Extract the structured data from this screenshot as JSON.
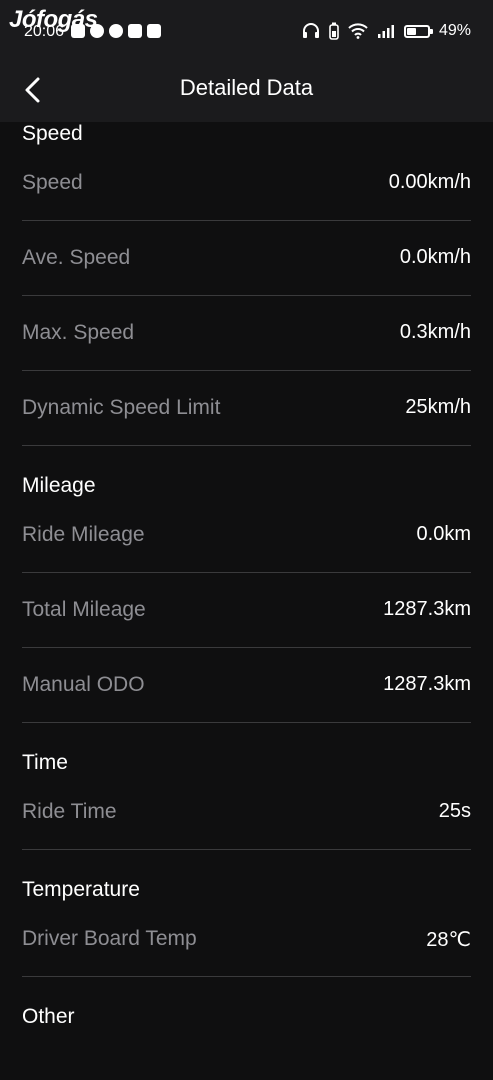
{
  "status_bar": {
    "watermark": "Jófogás",
    "time": "20:06",
    "battery_percent": "49%",
    "battery_level": 0.49
  },
  "header": {
    "title": "Detailed Data"
  },
  "sections": {
    "speed": {
      "title": "Speed",
      "rows": [
        {
          "label": "Speed",
          "value": "0.00km/h"
        },
        {
          "label": "Ave. Speed",
          "value": "0.0km/h"
        },
        {
          "label": "Max. Speed",
          "value": "0.3km/h"
        },
        {
          "label": "Dynamic Speed Limit",
          "value": "25km/h"
        }
      ]
    },
    "mileage": {
      "title": "Mileage",
      "rows": [
        {
          "label": "Ride Mileage",
          "value": "0.0km"
        },
        {
          "label": "Total Mileage",
          "value": "1287.3km"
        },
        {
          "label": "Manual ODO",
          "value": "1287.3km"
        }
      ]
    },
    "time": {
      "title": "Time",
      "rows": [
        {
          "label": "Ride Time",
          "value": "25s"
        }
      ]
    },
    "temperature": {
      "title": "Temperature",
      "rows": [
        {
          "label": "Driver Board Temp",
          "value": "28℃"
        }
      ]
    },
    "other": {
      "title": "Other"
    }
  },
  "colors": {
    "background": "#0f0f10",
    "header_background": "#1b1b1d",
    "label_text": "#8e8e93",
    "value_text": "#ffffff",
    "divider": "#3a3a3c"
  }
}
